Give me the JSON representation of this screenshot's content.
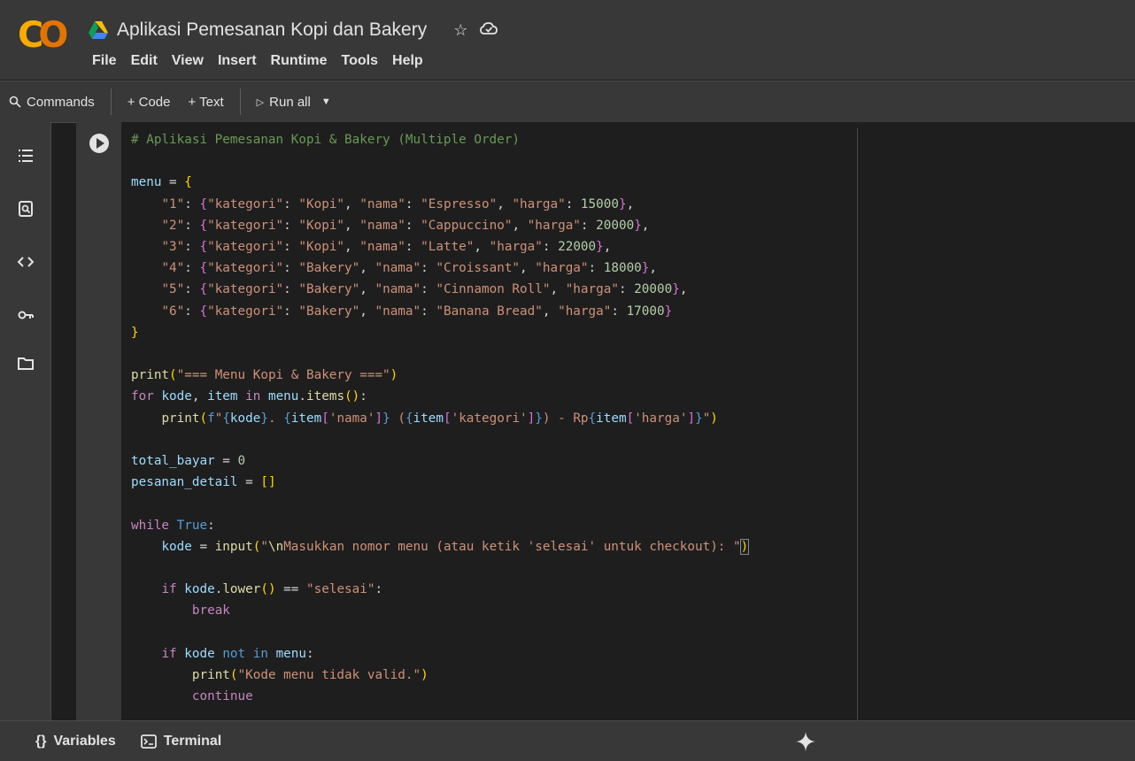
{
  "header": {
    "title": "Aplikasi Pemesanan Kopi dan Bakery",
    "menu": [
      "File",
      "Edit",
      "View",
      "Insert",
      "Runtime",
      "Tools",
      "Help"
    ]
  },
  "toolbar": {
    "commands": "Commands",
    "code": "+ Code",
    "text": "+ Text",
    "run_all": "Run all"
  },
  "bottombar": {
    "variables": "Variables",
    "terminal": "Terminal"
  },
  "colors": {
    "accent_orange": "#f9ab00",
    "surface": "#383838",
    "editor_bg": "#1e1e1e"
  },
  "code": {
    "lines": [
      "# Aplikasi Pemesanan Kopi & Bakery (Multiple Order)",
      "",
      "menu = {",
      "    \"1\": {\"kategori\": \"Kopi\", \"nama\": \"Espresso\", \"harga\": 15000},",
      "    \"2\": {\"kategori\": \"Kopi\", \"nama\": \"Cappuccino\", \"harga\": 20000},",
      "    \"3\": {\"kategori\": \"Kopi\", \"nama\": \"Latte\", \"harga\": 22000},",
      "    \"4\": {\"kategori\": \"Bakery\", \"nama\": \"Croissant\", \"harga\": 18000},",
      "    \"5\": {\"kategori\": \"Bakery\", \"nama\": \"Cinnamon Roll\", \"harga\": 20000},",
      "    \"6\": {\"kategori\": \"Bakery\", \"nama\": \"Banana Bread\", \"harga\": 17000}",
      "}",
      "",
      "print(\"=== Menu Kopi & Bakery ===\")",
      "for kode, item in menu.items():",
      "    print(f\"{kode}. {item['nama']} ({item['kategori']}) - Rp{item['harga']}\")",
      "",
      "total_bayar = 0",
      "pesanan_detail = []",
      "",
      "while True:",
      "    kode = input(\"\\nMasukkan nomor menu (atau ketik 'selesai' untuk checkout): \")",
      "",
      "    if kode.lower() == \"selesai\":",
      "        break",
      "",
      "    if kode not in menu:",
      "        print(\"Kode menu tidak valid.\")",
      "        continue"
    ]
  }
}
